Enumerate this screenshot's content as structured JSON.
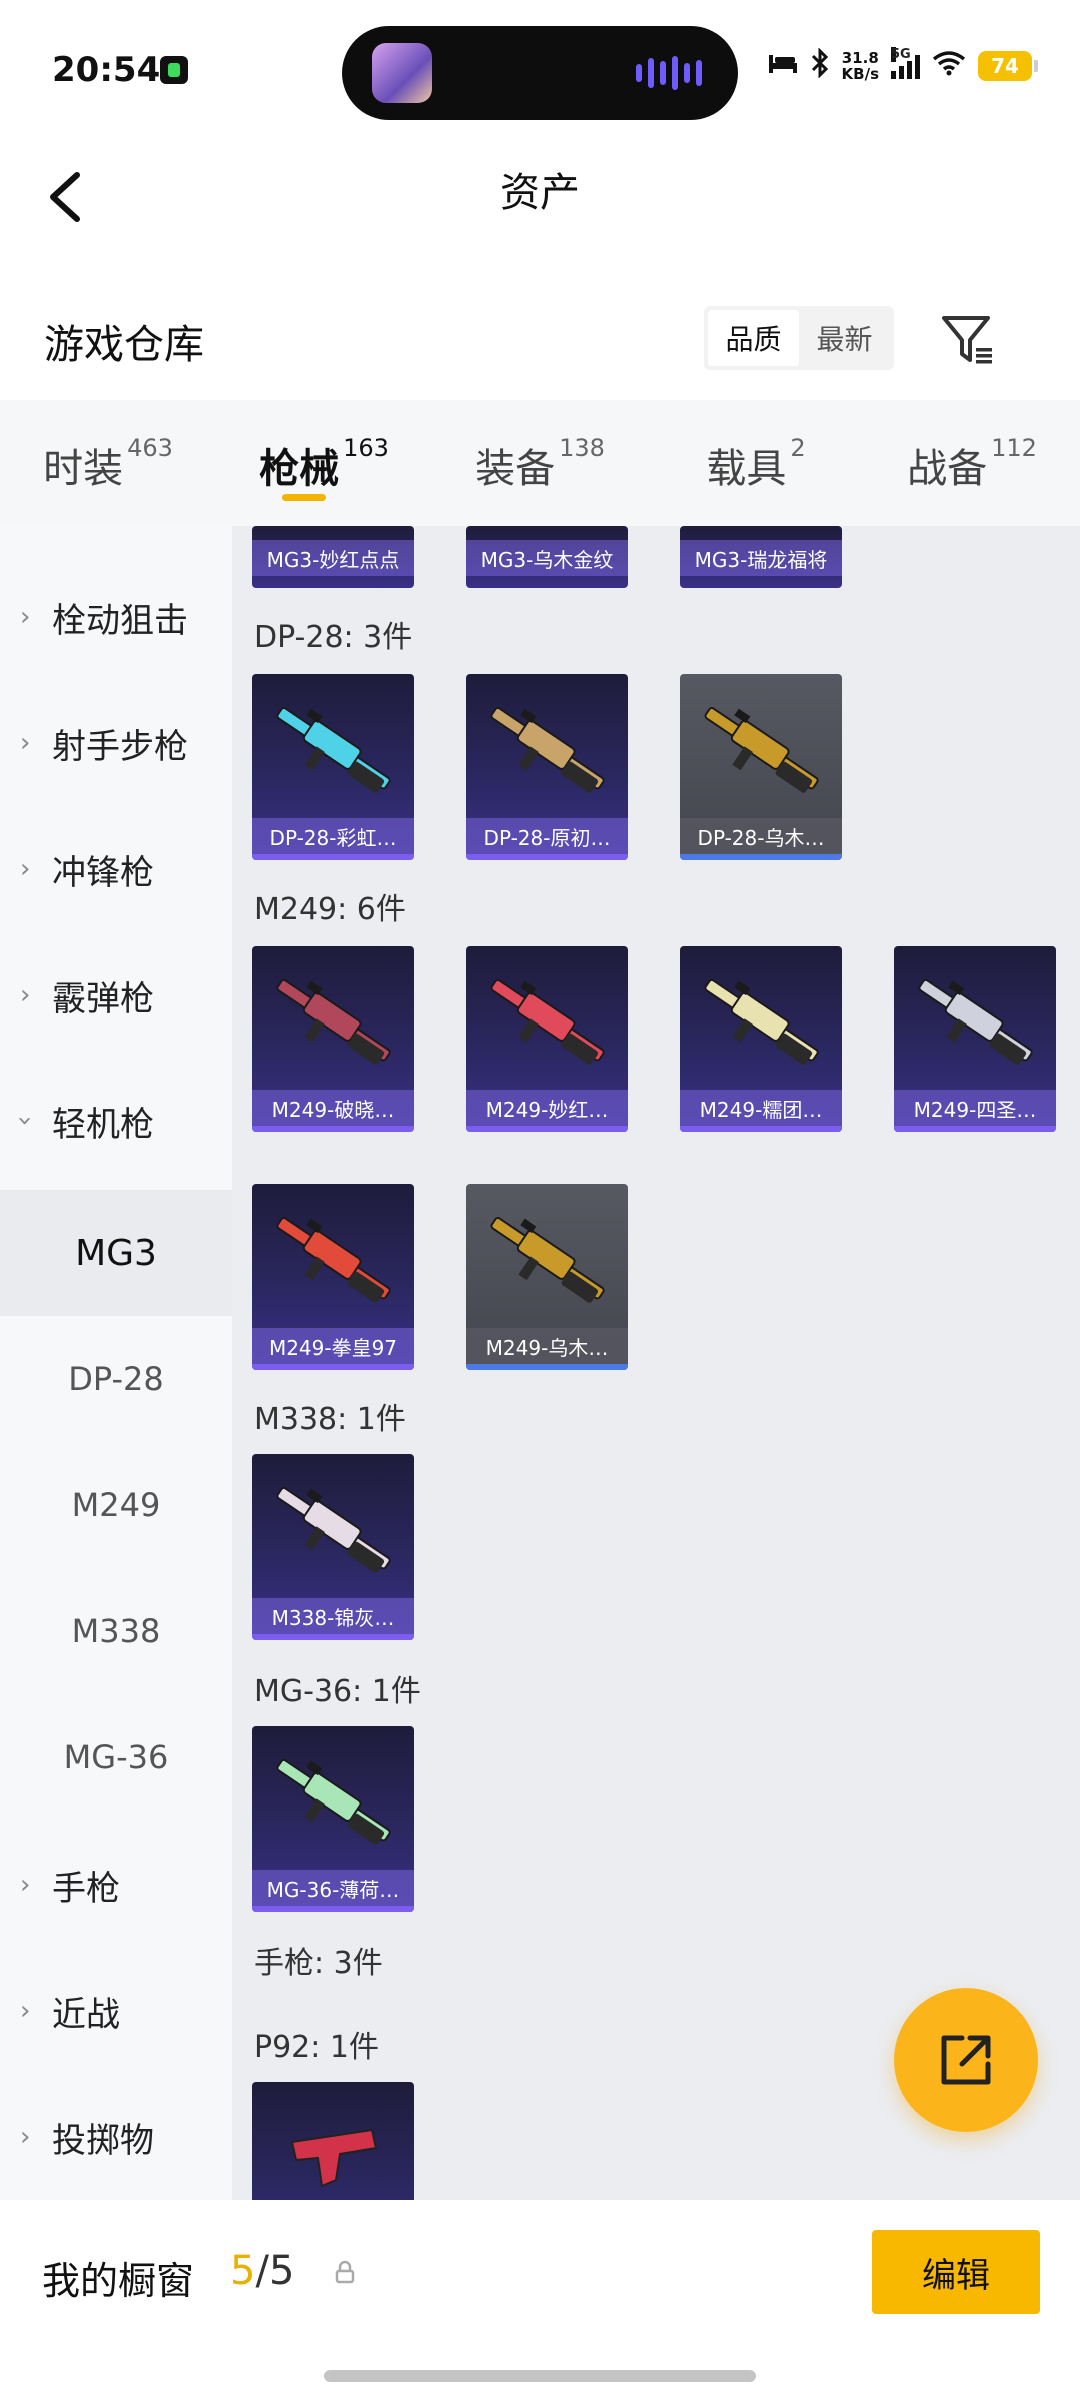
{
  "status_bar": {
    "time": "20:54",
    "net_speed": "31.8",
    "net_unit": "KB/s",
    "signal_label": "5G",
    "battery": "74"
  },
  "nav": {
    "title": "资产"
  },
  "warehouse": {
    "title": "游戏仓库",
    "sort_options": [
      "品质",
      "最新"
    ],
    "sort_active": "品质"
  },
  "tabs": [
    {
      "label": "时装",
      "count": "463"
    },
    {
      "label": "枪械",
      "count": "163",
      "active": true
    },
    {
      "label": "装备",
      "count": "138"
    },
    {
      "label": "载具",
      "count": "2"
    },
    {
      "label": "战备",
      "count": "112"
    }
  ],
  "sidebar": {
    "categories": [
      "栓动狙击",
      "射手步枪",
      "冲锋枪",
      "霰弹枪",
      "轻机枪"
    ],
    "lmg_items": [
      "MG3",
      "DP-28",
      "M249",
      "M338",
      "MG-36"
    ],
    "active_item": "MG3",
    "categories_after": [
      "手枪",
      "近战",
      "投掷物"
    ]
  },
  "content": {
    "mg3_items": [
      "MG3-妙红点点",
      "MG3-乌木金纹",
      "MG3-瑞龙福将"
    ],
    "groups": [
      {
        "title": "DP-28: 3件",
        "items": [
          {
            "name": "DP-28-彩虹…",
            "style": "purple",
            "gun": "#4fd1e8"
          },
          {
            "name": "DP-28-原初…",
            "style": "purple",
            "gun": "#c9a46a"
          },
          {
            "name": "DP-28-乌木…",
            "style": "gray",
            "gun": "#c89a2a"
          }
        ]
      },
      {
        "title": "M249: 6件",
        "items": [
          {
            "name": "M249-破晓…",
            "style": "purple",
            "gun": "#b0475a"
          },
          {
            "name": "M249-妙红…",
            "style": "purple",
            "gun": "#e04a5a"
          },
          {
            "name": "M249-糯团…",
            "style": "purple",
            "gun": "#e8e2b0"
          },
          {
            "name": "M249-四圣…",
            "style": "purple",
            "gun": "#cfd2dc"
          },
          {
            "name": "M249-拳皇97",
            "style": "purple",
            "gun": "#e24a3a"
          },
          {
            "name": "M249-乌木…",
            "style": "gray",
            "gun": "#c89a2a"
          }
        ]
      },
      {
        "title": "M338: 1件",
        "items": [
          {
            "name": "M338-锦灰…",
            "style": "purple",
            "gun": "#e6dce6"
          }
        ]
      },
      {
        "title": "MG-36: 1件",
        "items": [
          {
            "name": "MG-36-薄荷…",
            "style": "purple",
            "gun": "#a8e6b8"
          }
        ]
      }
    ],
    "pistol_heading": "手枪: 3件",
    "p92_heading": "P92: 1件"
  },
  "bottom_bar": {
    "label": "我的橱窗",
    "current": "5",
    "separator": "/",
    "total": "5",
    "edit_label": "编辑"
  },
  "icons": {
    "back": "chevron-left-icon",
    "filter": "filter-icon",
    "fab": "external-link-icon",
    "lock": "lock-icon"
  },
  "colors": {
    "accent": "#f5b400",
    "card_purple": "#2b2760",
    "card_gray": "#4a4c55"
  }
}
